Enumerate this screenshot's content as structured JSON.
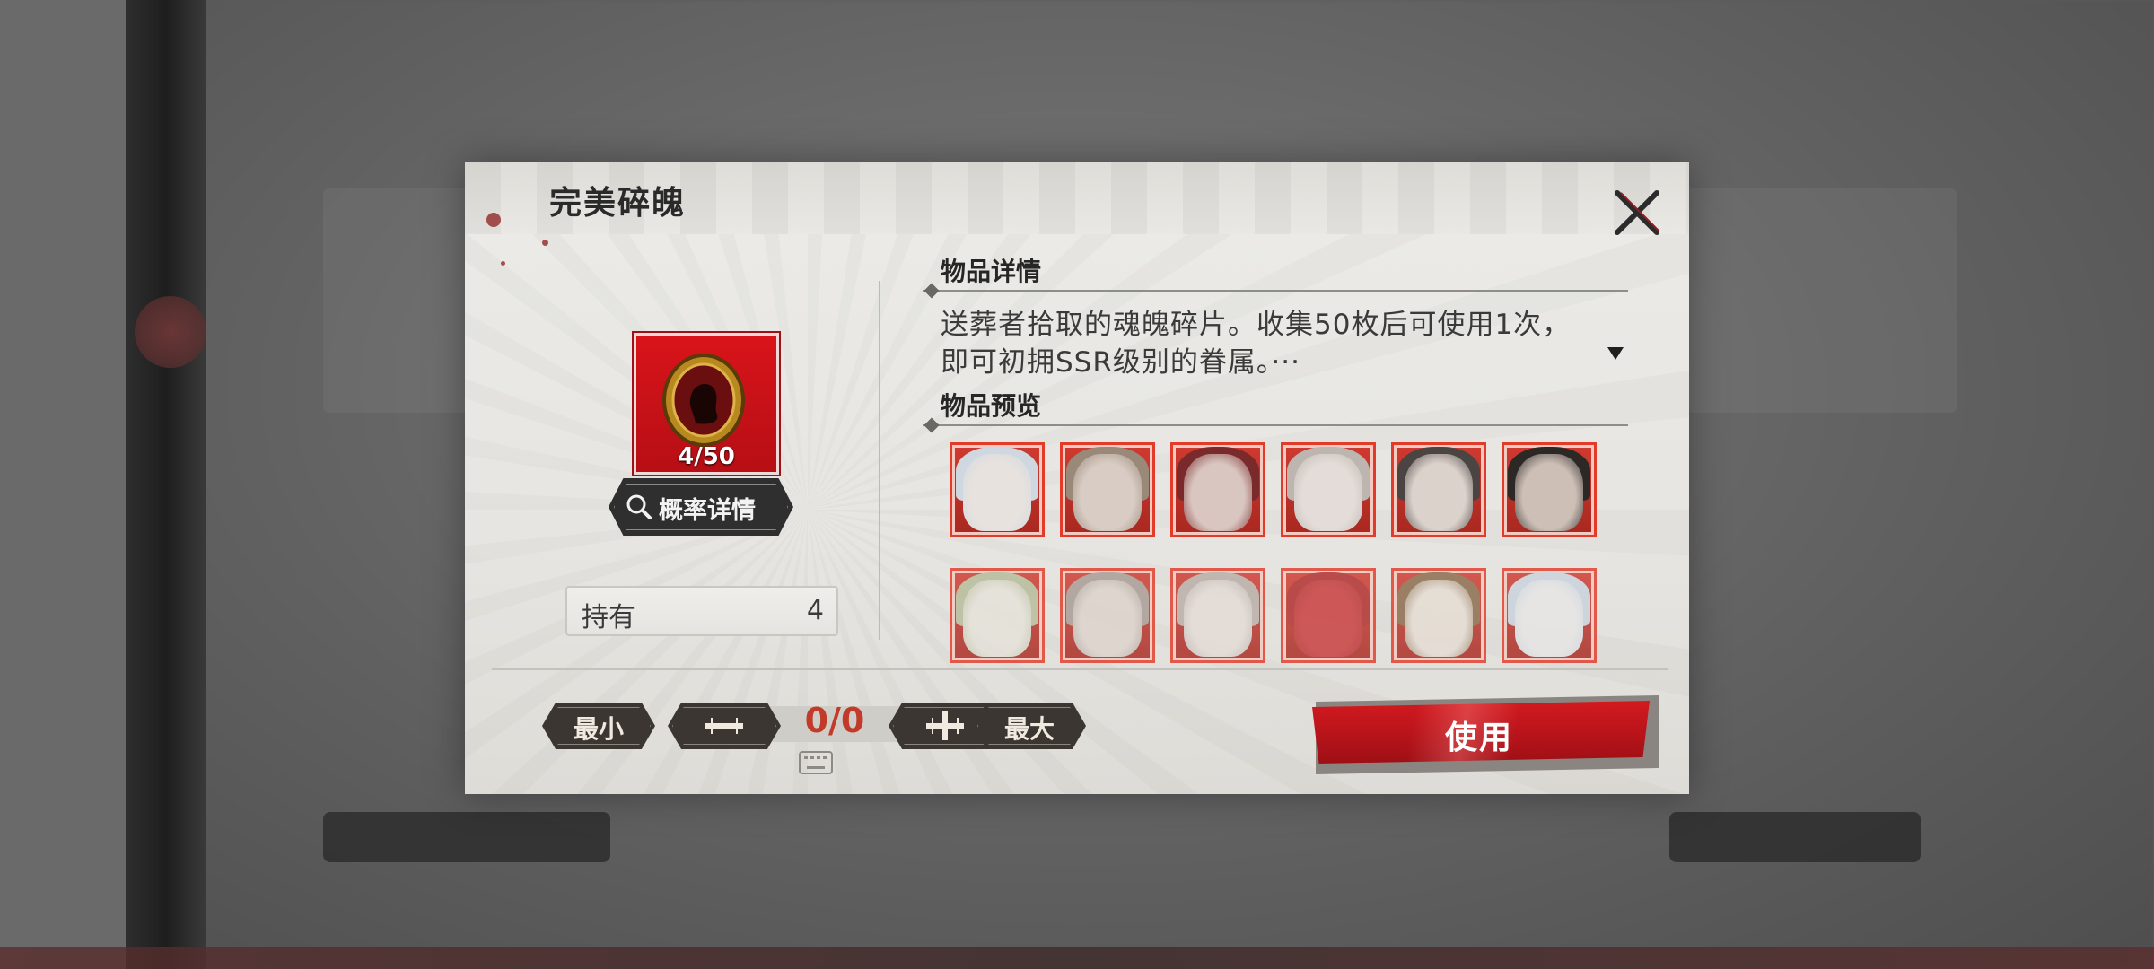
{
  "dialog": {
    "title": "完美碎魄"
  },
  "item": {
    "count": "4/50",
    "probability_button": "概率详情",
    "owned_label": "持有",
    "owned_value": "4"
  },
  "details": {
    "section_title": "物品详情",
    "description": "送葬者拾取的魂魄碎片。收集50枚后可使用1次，即可初拥SSR级别的眷属。···"
  },
  "preview": {
    "section_title": "物品预览",
    "portraits": [
      {
        "name": "portrait-1",
        "hair": "#cfd8e0",
        "skin": "#e8e2de"
      },
      {
        "name": "portrait-2",
        "hair": "#9a8878",
        "skin": "#d8ccc4"
      },
      {
        "name": "portrait-3",
        "hair": "#7a2a2a",
        "skin": "#d9c6c0"
      },
      {
        "name": "portrait-4",
        "hair": "#bdb6b0",
        "skin": "#e4dcd8"
      },
      {
        "name": "portrait-5",
        "hair": "#4a4442",
        "skin": "#dcd2cc"
      },
      {
        "name": "portrait-6",
        "hair": "#2c2826",
        "skin": "#cdbfb6"
      },
      {
        "name": "portrait-7",
        "hair": "#b7bc9a",
        "skin": "#e6e2da"
      },
      {
        "name": "portrait-8",
        "hair": "#a89c94",
        "skin": "#ddd3cc"
      },
      {
        "name": "portrait-9",
        "hair": "#b9aea6",
        "skin": "#e3dbd6"
      },
      {
        "name": "portrait-10",
        "hair": "#b02a2a",
        "skin": "#c83a3a"
      },
      {
        "name": "portrait-11",
        "hair": "#8a6a4a",
        "skin": "#e6ddd4"
      },
      {
        "name": "portrait-12",
        "hair": "#c9d2dc",
        "skin": "#e8e6e6"
      }
    ]
  },
  "controls": {
    "min_label": "最小",
    "max_label": "最大",
    "quantity": "0/0",
    "use_label": "使用"
  },
  "colors": {
    "accent_red": "#c8161c",
    "quantity_red": "#c23b2a",
    "dark_button": "#3b3631"
  },
  "icons": {
    "close": "close-icon",
    "search": "search-icon",
    "minus": "minus-icon",
    "plus": "plus-icon",
    "keyboard": "keyboard-icon",
    "expand": "expand-arrow-icon"
  }
}
